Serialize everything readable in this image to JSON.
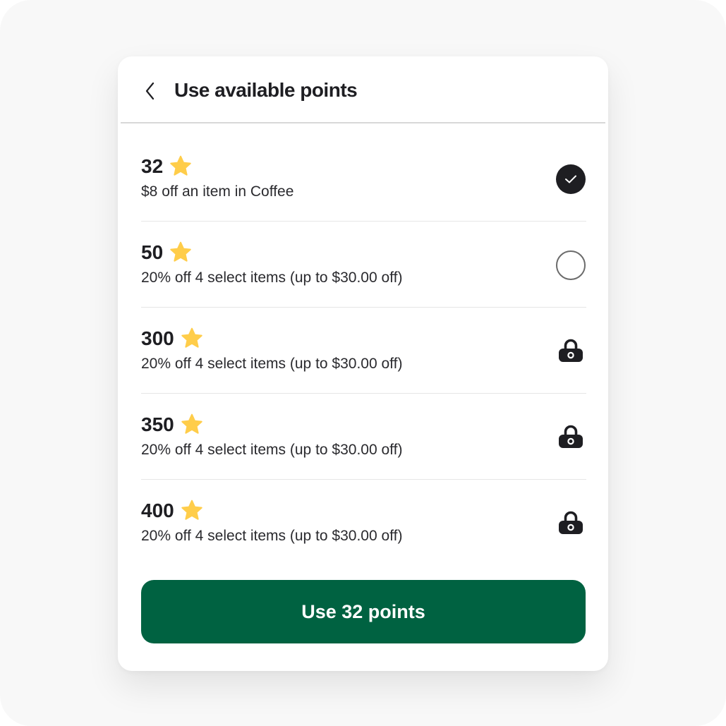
{
  "header": {
    "back_icon": "chevron-left-icon",
    "title": "Use available points"
  },
  "rewards": [
    {
      "points": "32",
      "description": "$8 off an item in Coffee",
      "state": "selected"
    },
    {
      "points": "50",
      "description": "20% off 4 select items (up to $30.00 off)",
      "state": "available"
    },
    {
      "points": "300",
      "description": "20% off 4 select items (up to $30.00 off)",
      "state": "locked"
    },
    {
      "points": "350",
      "description": "20% off 4 select items (up to $30.00 off)",
      "state": "locked"
    },
    {
      "points": "400",
      "description": "20% off 4 select items (up to $30.00 off)",
      "state": "locked"
    }
  ],
  "icons": {
    "points": "star-icon",
    "selected": "check-circle-icon",
    "available": "radio-empty-icon",
    "locked": "lock-icon"
  },
  "cta": {
    "label": "Use 32 points"
  },
  "colors": {
    "primary": "#006241",
    "star": "#FFCD4A",
    "text": "#1E1E22",
    "divider": "#E6E6E6"
  }
}
